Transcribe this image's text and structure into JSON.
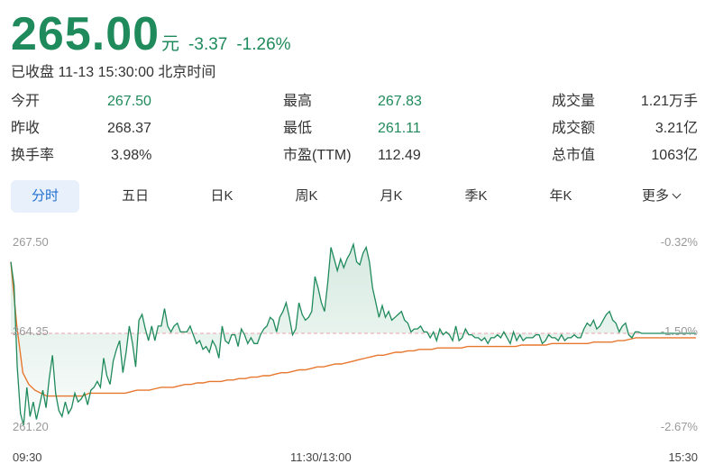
{
  "quote": {
    "price": "265.00",
    "unit": "元",
    "change": "-3.37",
    "change_pct": "-1.26%",
    "status": "已收盘 11-13 15:30:00 北京时间"
  },
  "stats": [
    {
      "label": "今开",
      "value": "267.50"
    },
    {
      "label": "最高",
      "value": "267.83"
    },
    {
      "label": "成交量",
      "value": "1.21万手"
    },
    {
      "label": "昨收",
      "value": "268.37"
    },
    {
      "label": "最低",
      "value": "261.11"
    },
    {
      "label": "成交额",
      "value": "3.21亿"
    },
    {
      "label": "换手率",
      "value": "3.98%"
    },
    {
      "label": "市盈(TTM)",
      "value": "112.49"
    },
    {
      "label": "总市值",
      "value": "1063亿"
    }
  ],
  "tabs": [
    "分时",
    "五日",
    "日K",
    "周K",
    "月K",
    "季K",
    "年K",
    "更多"
  ],
  "colors": {
    "up_down_green": "#1f8a5b",
    "avg_line": "#e8772e",
    "ref_line": "#e9a3a8",
    "active_tab": "#1f6fd1"
  },
  "icons": {
    "more": "chevron-down-icon"
  },
  "chart_data": {
    "type": "line",
    "y_left_ticks": [
      "267.50",
      "264.35",
      "261.20"
    ],
    "y_right_ticks": [
      "-0.32%",
      "-1.50%",
      "-2.67%"
    ],
    "x_ticks": [
      "09:30",
      "11:30/13:00",
      "15:30"
    ],
    "ylim": [
      261.2,
      267.5
    ],
    "reference_price": 264.35,
    "series": [
      {
        "values": [
          266.8,
          266.0,
          263.2,
          261.6,
          261.2,
          262.5,
          261.5,
          262.0,
          261.4,
          261.9,
          262.4,
          261.8,
          262.8,
          263.6,
          262.3,
          261.7,
          261.5,
          262.0,
          261.6,
          261.8,
          262.3,
          262.0,
          262.1,
          262.3,
          261.9,
          262.4,
          262.5,
          262.7,
          262.5,
          263.5,
          262.9,
          262.6,
          263.4,
          263.8,
          264.1,
          263.0,
          263.7,
          264.6,
          264.0,
          263.2,
          264.8,
          265.0,
          264.5,
          264.1,
          264.6,
          264.1,
          264.6,
          264.6,
          265.2,
          264.6,
          264.4,
          264.6,
          264.7,
          264.4,
          264.4,
          264.4,
          264.6,
          264.3,
          264.0,
          264.1,
          263.8,
          263.9,
          263.7,
          264.1,
          263.9,
          263.5,
          264.6,
          264.1,
          264.0,
          264.3,
          264.3,
          263.9,
          264.5,
          264.3,
          264.0,
          264.2,
          264.0,
          264.0,
          264.3,
          264.5,
          264.6,
          264.9,
          264.8,
          264.4,
          264.9,
          265.1,
          265.4,
          264.9,
          264.3,
          264.5,
          265.4,
          265.0,
          264.8,
          264.9,
          265.1,
          266.3,
          265.9,
          265.4,
          265.1,
          266.1,
          267.3,
          266.9,
          266.5,
          266.9,
          266.6,
          266.9,
          267.1,
          267.4,
          266.8,
          266.7,
          267.1,
          267.3,
          266.8,
          265.9,
          265.4,
          264.9,
          265.3,
          264.9,
          265.1,
          264.8,
          264.9,
          265.0,
          265.1,
          264.8,
          264.7,
          264.4,
          264.5,
          264.5,
          264.6,
          264.4,
          264.4,
          264.2,
          264.4,
          264.1,
          264.5,
          264.3,
          264.4,
          264.3,
          264.1,
          264.6,
          264.1,
          264.2,
          264.5,
          264.3,
          264.3,
          264.2,
          264.2,
          264.1,
          264.2,
          264.0,
          264.2,
          264.2,
          264.3,
          264.2,
          264.4,
          264.2,
          264.0,
          264.4,
          264.1,
          264.3,
          264.1,
          264.2,
          264.2,
          264.2,
          264.3,
          264.3,
          264.0,
          264.1,
          264.3,
          264.2,
          264.2,
          264.1,
          264.3,
          264.1,
          264.2,
          264.2,
          264.3,
          264.2,
          264.2,
          264.5,
          264.7,
          264.6,
          264.8,
          264.5,
          264.6,
          264.8,
          265.0,
          265.1,
          264.8,
          264.7,
          264.4,
          264.6,
          264.7,
          264.3,
          264.2,
          264.4,
          264.4,
          264.35,
          264.35,
          264.35,
          264.35,
          264.35,
          264.35,
          264.35,
          264.35,
          264.35,
          264.35,
          264.35,
          264.35,
          264.35,
          264.35,
          264.35,
          264.35,
          264.35,
          264.35
        ]
      },
      {
        "values": [
          266.8,
          264.6,
          263.0,
          262.6,
          262.4,
          262.3,
          262.2,
          262.2,
          262.2,
          262.2,
          262.2,
          262.2,
          262.2,
          262.3,
          262.3,
          262.3,
          262.3,
          262.3,
          262.3,
          262.3,
          262.35,
          262.4,
          262.4,
          262.4,
          262.45,
          262.5,
          262.5,
          262.5,
          262.55,
          262.6,
          262.6,
          262.65,
          262.65,
          262.7,
          262.7,
          262.7,
          262.75,
          262.75,
          262.8,
          262.8,
          262.85,
          262.85,
          262.9,
          262.9,
          262.95,
          263.0,
          263.0,
          263.05,
          263.1,
          263.1,
          263.15,
          263.2,
          263.2,
          263.25,
          263.3,
          263.3,
          263.35,
          263.4,
          263.45,
          263.5,
          263.55,
          263.6,
          263.6,
          263.65,
          263.7,
          263.7,
          263.75,
          263.75,
          263.8,
          263.8,
          263.8,
          263.85,
          263.85,
          263.85,
          263.85,
          263.85,
          263.9,
          263.9,
          263.9,
          263.9,
          263.9,
          263.9,
          263.9,
          263.9,
          263.9,
          263.95,
          263.95,
          263.95,
          263.95,
          263.95,
          264.0,
          264.0,
          264.0,
          264.0,
          264.0,
          264.0,
          264.0,
          264.05,
          264.05,
          264.05,
          264.05,
          264.1,
          264.1,
          264.15,
          264.2,
          264.2,
          264.2,
          264.2,
          264.2,
          264.2,
          264.2,
          264.2,
          264.2,
          264.2,
          264.2
        ]
      }
    ]
  }
}
